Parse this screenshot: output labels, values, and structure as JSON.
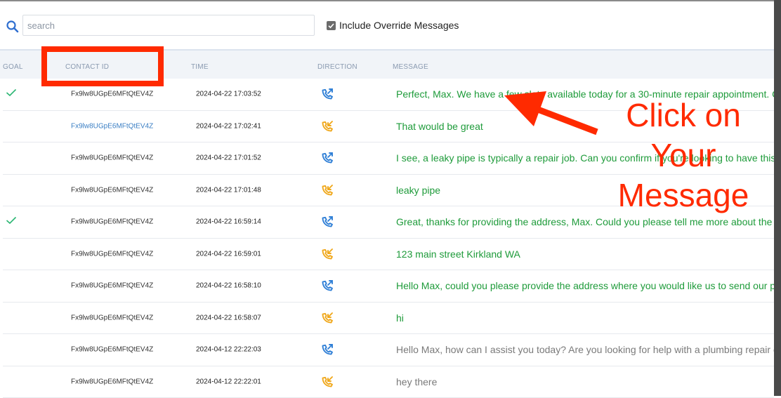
{
  "search": {
    "placeholder": "search"
  },
  "include_override": {
    "label": "Include Override Messages",
    "checked": true
  },
  "columns": {
    "goal": "GOAL",
    "contact_id": "CONTACT ID",
    "time": "TIME",
    "direction": "DIRECTION",
    "message": "MESSAGE"
  },
  "rows": [
    {
      "goal": true,
      "contact_id": "Fx9lw8UGpE6MFtQtEV4Z",
      "link": false,
      "time": "2024-04-22 17:03:52",
      "direction": "outbound",
      "message": "Perfect, Max. We have a few slots available today for a 30-minute repair appointment. C",
      "color": "green"
    },
    {
      "goal": false,
      "contact_id": "Fx9lw8UGpE6MFtQtEV4Z",
      "link": true,
      "time": "2024-04-22 17:02:41",
      "direction": "inbound",
      "message": "That would be great",
      "color": "green"
    },
    {
      "goal": false,
      "contact_id": "Fx9lw8UGpE6MFtQtEV4Z",
      "link": false,
      "time": "2024-04-22 17:01:52",
      "direction": "outbound",
      "message": "I see, a leaky pipe is typically a repair job. Can you confirm if you're looking to have this",
      "color": "green"
    },
    {
      "goal": false,
      "contact_id": "Fx9lw8UGpE6MFtQtEV4Z",
      "link": false,
      "time": "2024-04-22 17:01:48",
      "direction": "inbound",
      "message": "leaky pipe",
      "color": "green"
    },
    {
      "goal": true,
      "contact_id": "Fx9lw8UGpE6MFtQtEV4Z",
      "link": false,
      "time": "2024-04-22 16:59:14",
      "direction": "outbound",
      "message": "Great, thanks for providing the address, Max. Could you please tell me more about the",
      "color": "green"
    },
    {
      "goal": false,
      "contact_id": "Fx9lw8UGpE6MFtQtEV4Z",
      "link": false,
      "time": "2024-04-22 16:59:01",
      "direction": "inbound",
      "message": "123 main street Kirkland WA",
      "color": "green"
    },
    {
      "goal": false,
      "contact_id": "Fx9lw8UGpE6MFtQtEV4Z",
      "link": false,
      "time": "2024-04-22 16:58:10",
      "direction": "outbound",
      "message": "Hello Max, could you please provide the address where you would like us to send our p",
      "color": "green"
    },
    {
      "goal": false,
      "contact_id": "Fx9lw8UGpE6MFtQtEV4Z",
      "link": false,
      "time": "2024-04-22 16:58:07",
      "direction": "inbound",
      "message": "hi",
      "color": "green"
    },
    {
      "goal": false,
      "contact_id": "Fx9lw8UGpE6MFtQtEV4Z",
      "link": false,
      "time": "2024-04-12 22:22:03",
      "direction": "outbound",
      "message": "Hello Max, how can I assist you today? Are you looking for help with a plumbing repair c",
      "color": "gray"
    },
    {
      "goal": false,
      "contact_id": "Fx9lw8UGpE6MFtQtEV4Z",
      "link": false,
      "time": "2024-04-12 22:22:01",
      "direction": "inbound",
      "message": "hey there",
      "color": "gray"
    }
  ],
  "annotation": {
    "line1": "Click on",
    "line2": "Your",
    "line3": "Message"
  },
  "colors": {
    "outbound": "#2f7fd6",
    "inbound": "#f0a81c",
    "goal_check": "#2bb673",
    "annotation": "#ff2a00"
  },
  "icons": {
    "search": "search-icon",
    "outbound": "phone-outgoing-icon",
    "inbound": "phone-incoming-icon",
    "goal": "check-icon",
    "arrow": "arrow-icon"
  }
}
